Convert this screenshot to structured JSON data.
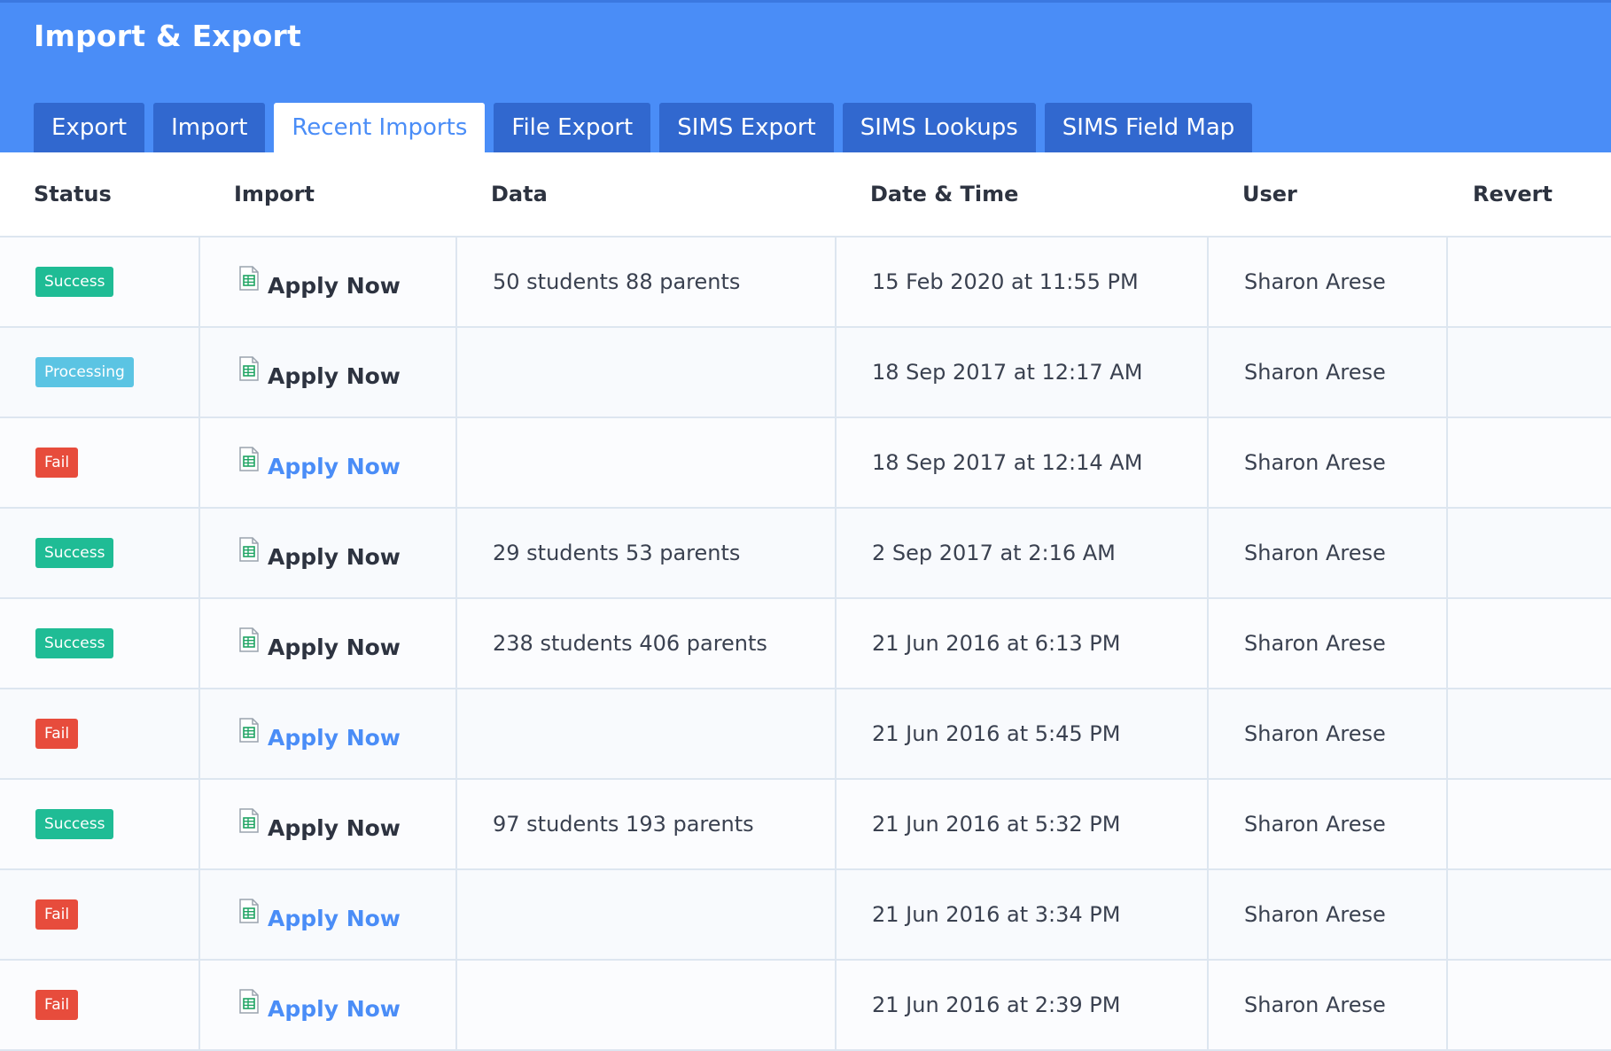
{
  "page": {
    "title": "Import & Export"
  },
  "tabs": [
    {
      "label": "Export",
      "active": false
    },
    {
      "label": "Import",
      "active": false
    },
    {
      "label": "Recent Imports",
      "active": true
    },
    {
      "label": "File Export",
      "active": false
    },
    {
      "label": "SIMS Export",
      "active": false
    },
    {
      "label": "SIMS Lookups",
      "active": false
    },
    {
      "label": "SIMS Field Map",
      "active": false
    }
  ],
  "table": {
    "headers": {
      "status": "Status",
      "import": "Import",
      "data": "Data",
      "date": "Date & Time",
      "user": "User",
      "revert": "Revert"
    },
    "rows": [
      {
        "status": "Success",
        "status_kind": "success",
        "import": "Apply Now",
        "data": "50 students 88 parents",
        "date": "15 Feb 2020 at 11:55 PM",
        "user": "Sharon Arese",
        "revert": ""
      },
      {
        "status": "Processing",
        "status_kind": "processing",
        "import": "Apply Now",
        "data": "",
        "date": "18 Sep 2017 at 12:17 AM",
        "user": "Sharon Arese",
        "revert": ""
      },
      {
        "status": "Fail",
        "status_kind": "fail",
        "import": "Apply Now",
        "data": "",
        "date": "18 Sep 2017 at 12:14 AM",
        "user": "Sharon Arese",
        "revert": ""
      },
      {
        "status": "Success",
        "status_kind": "success",
        "import": "Apply Now",
        "data": "29 students 53 parents",
        "date": "2 Sep 2017 at 2:16 AM",
        "user": "Sharon Arese",
        "revert": ""
      },
      {
        "status": "Success",
        "status_kind": "success",
        "import": "Apply Now",
        "data": "238 students 406 parents",
        "date": "21 Jun 2016 at 6:13 PM",
        "user": "Sharon Arese",
        "revert": ""
      },
      {
        "status": "Fail",
        "status_kind": "fail",
        "import": "Apply Now",
        "data": "",
        "date": "21 Jun 2016 at 5:45 PM",
        "user": "Sharon Arese",
        "revert": ""
      },
      {
        "status": "Success",
        "status_kind": "success",
        "import": "Apply Now",
        "data": "97 students 193 parents",
        "date": "21 Jun 2016 at 5:32 PM",
        "user": "Sharon Arese",
        "revert": ""
      },
      {
        "status": "Fail",
        "status_kind": "fail",
        "import": "Apply Now",
        "data": "",
        "date": "21 Jun 2016 at 3:34 PM",
        "user": "Sharon Arese",
        "revert": ""
      },
      {
        "status": "Fail",
        "status_kind": "fail",
        "import": "Apply Now",
        "data": "",
        "date": "21 Jun 2016 at 2:39 PM",
        "user": "Sharon Arese",
        "revert": ""
      }
    ]
  },
  "colors": {
    "header_bg": "#4a8df7",
    "tab_bg": "#3168cf",
    "success": "#1fbc95",
    "processing": "#5bc4e3",
    "fail": "#e74c3c",
    "link": "#4a8df7"
  },
  "icons": {
    "import_file": "spreadsheet-file-icon"
  }
}
